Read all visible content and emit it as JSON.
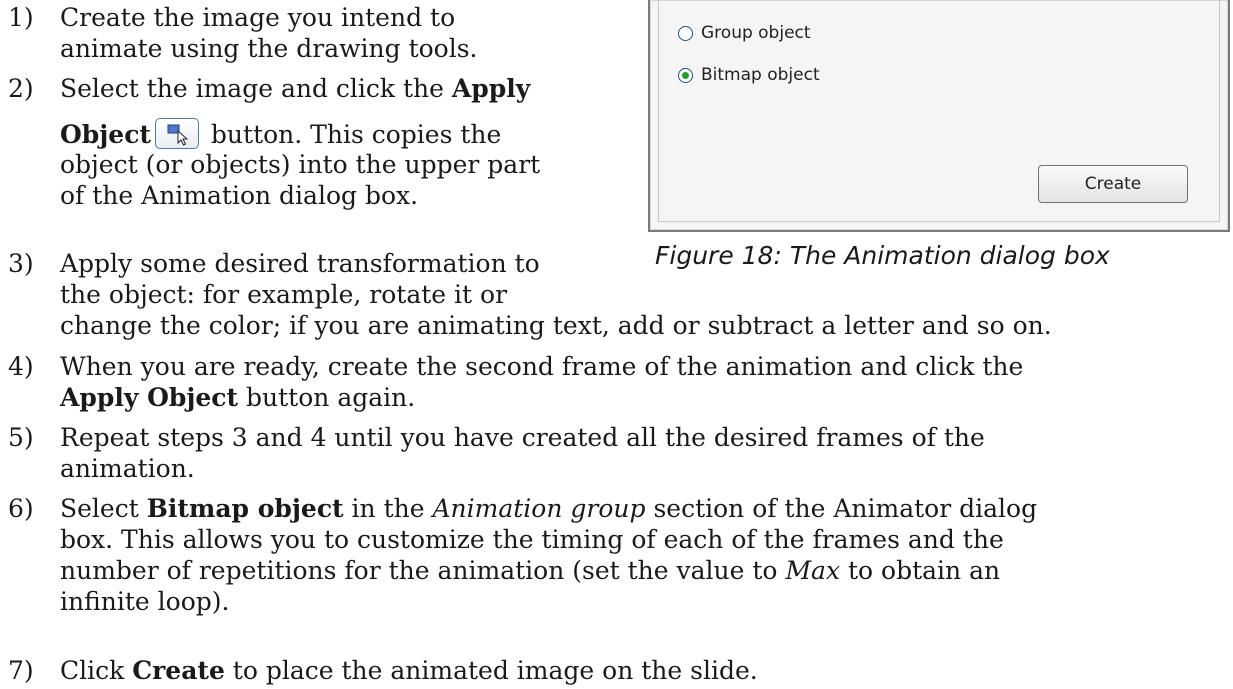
{
  "dialog": {
    "options": [
      {
        "label": "Group object",
        "checked": false
      },
      {
        "label": "Bitmap object",
        "checked": true
      }
    ],
    "create_label": "Create"
  },
  "figure_caption": "Figure 18: The Animation dialog box",
  "icon": "apply-object-icon",
  "steps": {
    "s1": {
      "num": "1)",
      "l1": "Create the image you intend to",
      "l2": "animate using the drawing tools."
    },
    "s2": {
      "num": "2)",
      "l1a": "Select the image and click the ",
      "l1b": "Apply",
      "l2a": "Object",
      "l2b": " button. This copies the",
      "l3": "object (or objects) into the upper part",
      "l4": "of the Animation dialog box."
    },
    "s3": {
      "num": "3)",
      "l1": "Apply some desired transformation to",
      "l2": "the object: for example, rotate it or",
      "l3": "change the color; if you are animating text, add or subtract a letter and so on."
    },
    "s4": {
      "num": "4)",
      "l1": "When you are ready, create the second frame of the animation and click the",
      "l2a": "Apply Object",
      "l2b": " button again."
    },
    "s5": {
      "num": "5)",
      "l1": "Repeat steps 3 and 4 until you have created all the desired frames of the",
      "l2": "animation."
    },
    "s6": {
      "num": "6)",
      "l1a": "Select ",
      "l1b": "Bitmap object",
      "l1c": " in the ",
      "l1d": "Animation group",
      "l1e": " section of the Animator dialog",
      "l2": "box. This allows you to customize the timing of each of the frames and the",
      "l3": "number of repetitions for the animation (set the value to ",
      "l3b": "Max",
      "l3c": " to obtain an",
      "l4": "infinite loop)."
    },
    "s7": {
      "num": "7)",
      "l1a": "Click ",
      "l1b": "Create",
      "l1c": " to place the animated image on the slide."
    }
  }
}
